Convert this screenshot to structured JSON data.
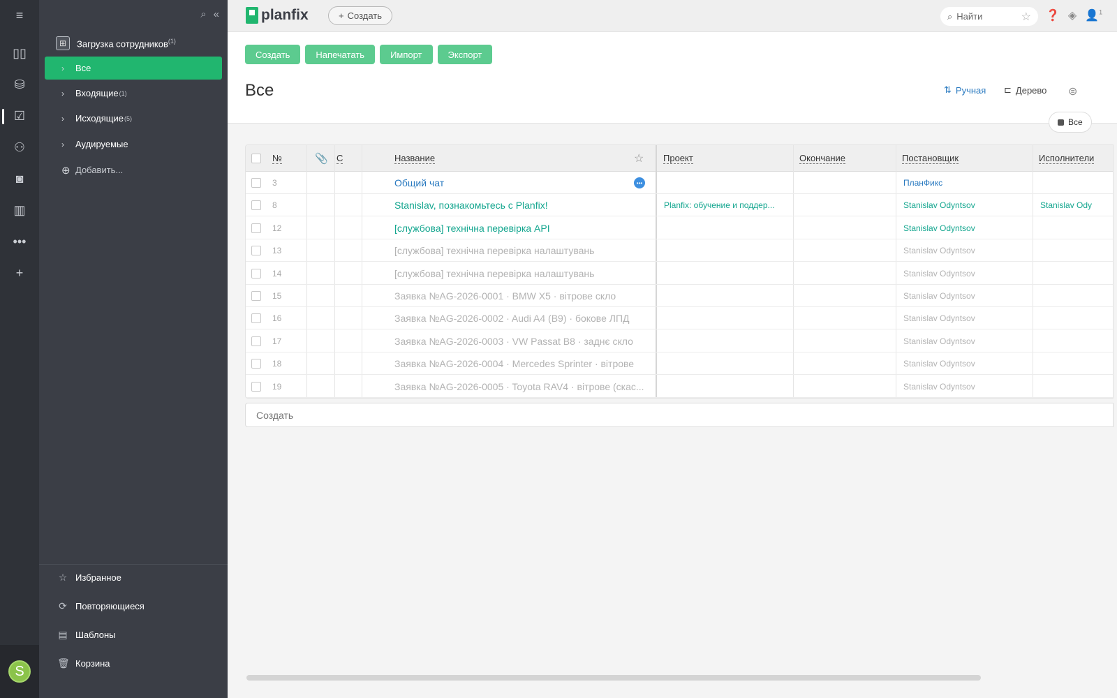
{
  "rail": {
    "items": [
      "menu-icon",
      "dashboard-icon",
      "inbox-icon",
      "tasks-icon",
      "contacts-icon",
      "employees-icon",
      "reports-icon",
      "more-icon",
      "add-icon"
    ],
    "avatar_letter": "S"
  },
  "sidebar": {
    "root_label": "Загрузка сотрудников",
    "root_count": "(1)",
    "items": [
      {
        "label": "Все",
        "count": "",
        "active": true
      },
      {
        "label": "Входящие",
        "count": "(1)"
      },
      {
        "label": "Исходящие",
        "count": "(5)"
      },
      {
        "label": "Аудируемые",
        "count": ""
      }
    ],
    "add_label": "Добавить...",
    "bottom": [
      {
        "label": "Избранное",
        "icon": "star-icon"
      },
      {
        "label": "Повторяющиеся",
        "icon": "repeat-icon"
      },
      {
        "label": "Шаблоны",
        "icon": "template-icon"
      },
      {
        "label": "Корзина",
        "icon": "trash-icon"
      }
    ]
  },
  "topbar": {
    "logo": "planfix",
    "create_label": "Создать",
    "search_placeholder": "Найти",
    "profile_badge": "1"
  },
  "toolbar": {
    "create": "Создать",
    "print": "Напечатать",
    "import": "Импорт",
    "export": "Экспорт"
  },
  "page": {
    "title": "Все",
    "sort_label": "Ручная",
    "tree_label": "Дерево",
    "filter_pill": "Все"
  },
  "table": {
    "headers": {
      "num": "№",
      "c": "С",
      "name": "Название",
      "project": "Проект",
      "deadline": "Окончание",
      "assigner": "Постановщик",
      "executor": "Исполнители"
    },
    "rows": [
      {
        "num": "3",
        "name": "Общий чат",
        "project": "",
        "assigner": "ПланФикс",
        "executor": "",
        "state": "blue"
      },
      {
        "num": "8",
        "name": "Stanislav, познакомьтесь с Planfix!",
        "project": "Planfix: обучение и поддер...",
        "assigner": "Stanislav Odyntsov",
        "executor": "Stanislav Ody",
        "state": "teal"
      },
      {
        "num": "12",
        "name": "[службова] технічна перевірка API",
        "project": "",
        "assigner": "Stanislav Odyntsov",
        "executor": "",
        "state": "teal"
      },
      {
        "num": "13",
        "name": "[службова] технічна перевірка налаштувань",
        "project": "",
        "assigner": "Stanislav Odyntsov",
        "executor": "",
        "state": "grey"
      },
      {
        "num": "14",
        "name": "[службова] технічна перевірка налаштувань",
        "project": "",
        "assigner": "Stanislav Odyntsov",
        "executor": "",
        "state": "grey"
      },
      {
        "num": "15",
        "name": "Заявка №AG-2026-0001 · BMW X5 · вітрове скло",
        "project": "",
        "assigner": "Stanislav Odyntsov",
        "executor": "",
        "state": "grey"
      },
      {
        "num": "16",
        "name": "Заявка №AG-2026-0002 · Audi A4 (B9) · бокове ЛПД",
        "project": "",
        "assigner": "Stanislav Odyntsov",
        "executor": "",
        "state": "grey"
      },
      {
        "num": "17",
        "name": "Заявка №AG-2026-0003 · VW Passat B8 · заднє скло",
        "project": "",
        "assigner": "Stanislav Odyntsov",
        "executor": "",
        "state": "grey"
      },
      {
        "num": "18",
        "name": "Заявка №AG-2026-0004 · Mercedes Sprinter · вітрове",
        "project": "",
        "assigner": "Stanislav Odyntsov",
        "executor": "",
        "state": "grey"
      },
      {
        "num": "19",
        "name": "Заявка №AG-2026-0005 · Toyota RAV4 · вітрове (скас...",
        "project": "",
        "assigner": "Stanislav Odyntsov",
        "executor": "",
        "state": "grey"
      }
    ],
    "create_row_label": "Создать"
  },
  "colors": {
    "accent": "#21b66f",
    "button": "#5ccb8f",
    "link_blue": "#2a7ac0",
    "link_teal": "#14a68f",
    "muted": "#b3b3b3"
  }
}
